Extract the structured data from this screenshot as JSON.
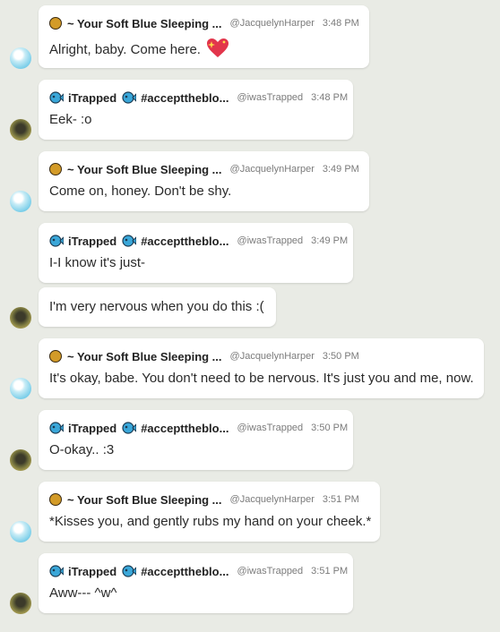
{
  "messages": [
    {
      "author": "~ Your Soft Blue Sleeping ...",
      "handle": "@JacquelynHarper",
      "time": "3:48 PM",
      "text": "Alright, baby. Come here.",
      "emoji": "sparkling-heart"
    },
    {
      "author": "iTrapped",
      "tag": "#accepttheblo...",
      "handle": "@iwasTrapped",
      "time": "3:48 PM",
      "text": "Eek- :o"
    },
    {
      "author": "~ Your Soft Blue Sleeping ...",
      "handle": "@JacquelynHarper",
      "time": "3:49 PM",
      "text": "Come on, honey. Don't be shy."
    },
    {
      "author": "iTrapped",
      "tag": "#accepttheblo...",
      "handle": "@iwasTrapped",
      "time": "3:49 PM",
      "text": "I-I know it's just-",
      "followup": "I'm very nervous when you do this :("
    },
    {
      "author": "~ Your Soft Blue Sleeping ...",
      "handle": "@JacquelynHarper",
      "time": "3:50 PM",
      "text": "It's okay, babe. You don't need to be nervous. It's just you and me, now."
    },
    {
      "author": "iTrapped",
      "tag": "#accepttheblo...",
      "handle": "@iwasTrapped",
      "time": "3:50 PM",
      "text": "O-okay.. :3"
    },
    {
      "author": "~ Your Soft Blue Sleeping ...",
      "handle": "@JacquelynHarper",
      "time": "3:51 PM",
      "text": "*Kisses you, and gently rubs my hand on your cheek.*"
    },
    {
      "author": "iTrapped",
      "tag": "#accepttheblo...",
      "handle": "@iwasTrapped",
      "time": "3:51 PM",
      "text": "Aww--- ^w^"
    }
  ],
  "colors": {
    "background": "#e9ebe5",
    "bubble": "#ffffff",
    "badge": "#d39b28",
    "fish": "#3aa7d9"
  }
}
